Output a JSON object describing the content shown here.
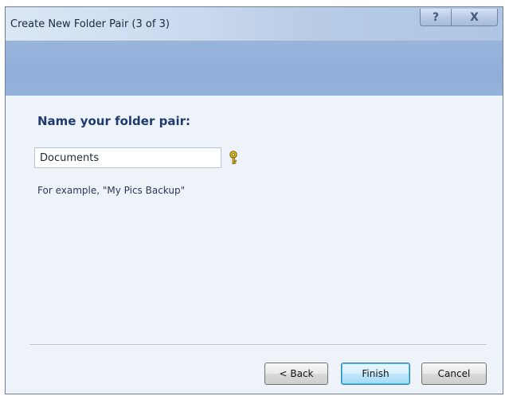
{
  "window": {
    "title": "Create New Folder Pair (3 of 3)",
    "help_glyph": "?",
    "close_glyph": "X"
  },
  "main": {
    "heading": "Name your folder pair:",
    "name_field": {
      "value": "Documents",
      "placeholder": ""
    },
    "hint_icon": "key-hint-icon",
    "example": "For example, \"My Pics Backup\""
  },
  "footer": {
    "back_label": "< Back",
    "finish_label": "Finish",
    "cancel_label": "Cancel"
  },
  "colors": {
    "heading": "#1f3a6e",
    "banner": "#8faed8",
    "background": "#eef3f9",
    "default_button_border": "#3c7fb1"
  }
}
